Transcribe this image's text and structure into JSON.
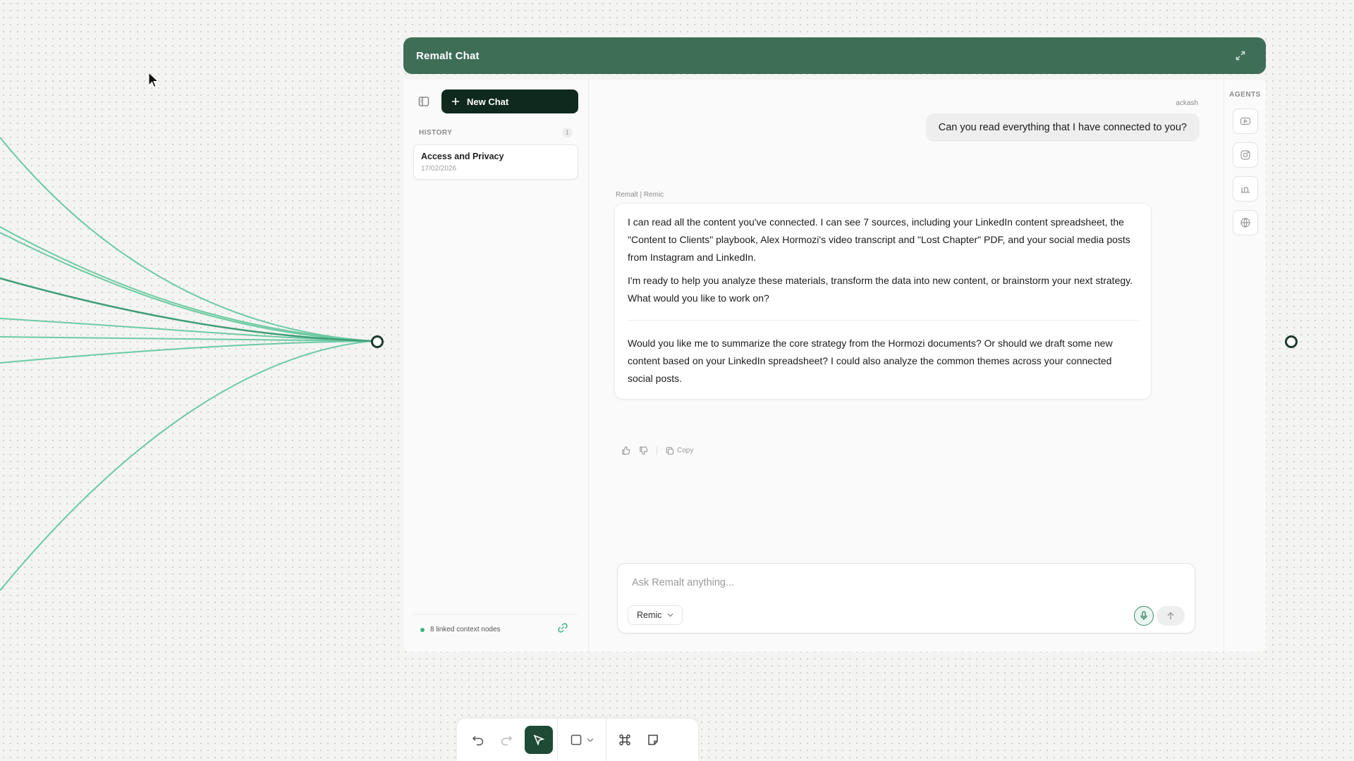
{
  "window": {
    "title": "Remalt Chat"
  },
  "sidebar": {
    "new_chat_label": "New Chat",
    "history_label": "HISTORY",
    "history_count": "1",
    "items": [
      {
        "title": "Access and Privacy",
        "date": "17/02/2026"
      }
    ],
    "footer_text": "8 linked context nodes"
  },
  "conversation": {
    "user_name": "ackash",
    "user_message": "Can you read everything that I have connected to you?",
    "assistant_name": "Remalt | Remic",
    "assistant_paragraphs": [
      "I can read all the content you've connected. I can see 7 sources, including your LinkedIn content spreadsheet, the \"Content to Clients\" playbook, Alex Hormozi's video transcript and \"Lost Chapter\" PDF, and your social media posts from Instagram and LinkedIn.",
      "I'm ready to help you analyze these materials, transform the data into new content, or brainstorm your next strategy. What would you like to work on?",
      "Would you like me to summarize the core strategy from the Hormozi documents? Or should we draft some new content based on your LinkedIn spreadsheet? I could also analyze the common themes across your connected social posts."
    ],
    "copy_label": "Copy"
  },
  "composer": {
    "placeholder": "Ask Remalt anything...",
    "model": "Remic"
  },
  "agents": {
    "label": "AGENTS",
    "icons": [
      "youtube-icon",
      "instagram-icon",
      "linkedin-icon",
      "globe-icon"
    ]
  },
  "colors": {
    "titlebar": "#3f6e57",
    "button_dark": "#10291f",
    "accent_green": "#3fb37f",
    "line_green": "#5cc49a"
  }
}
